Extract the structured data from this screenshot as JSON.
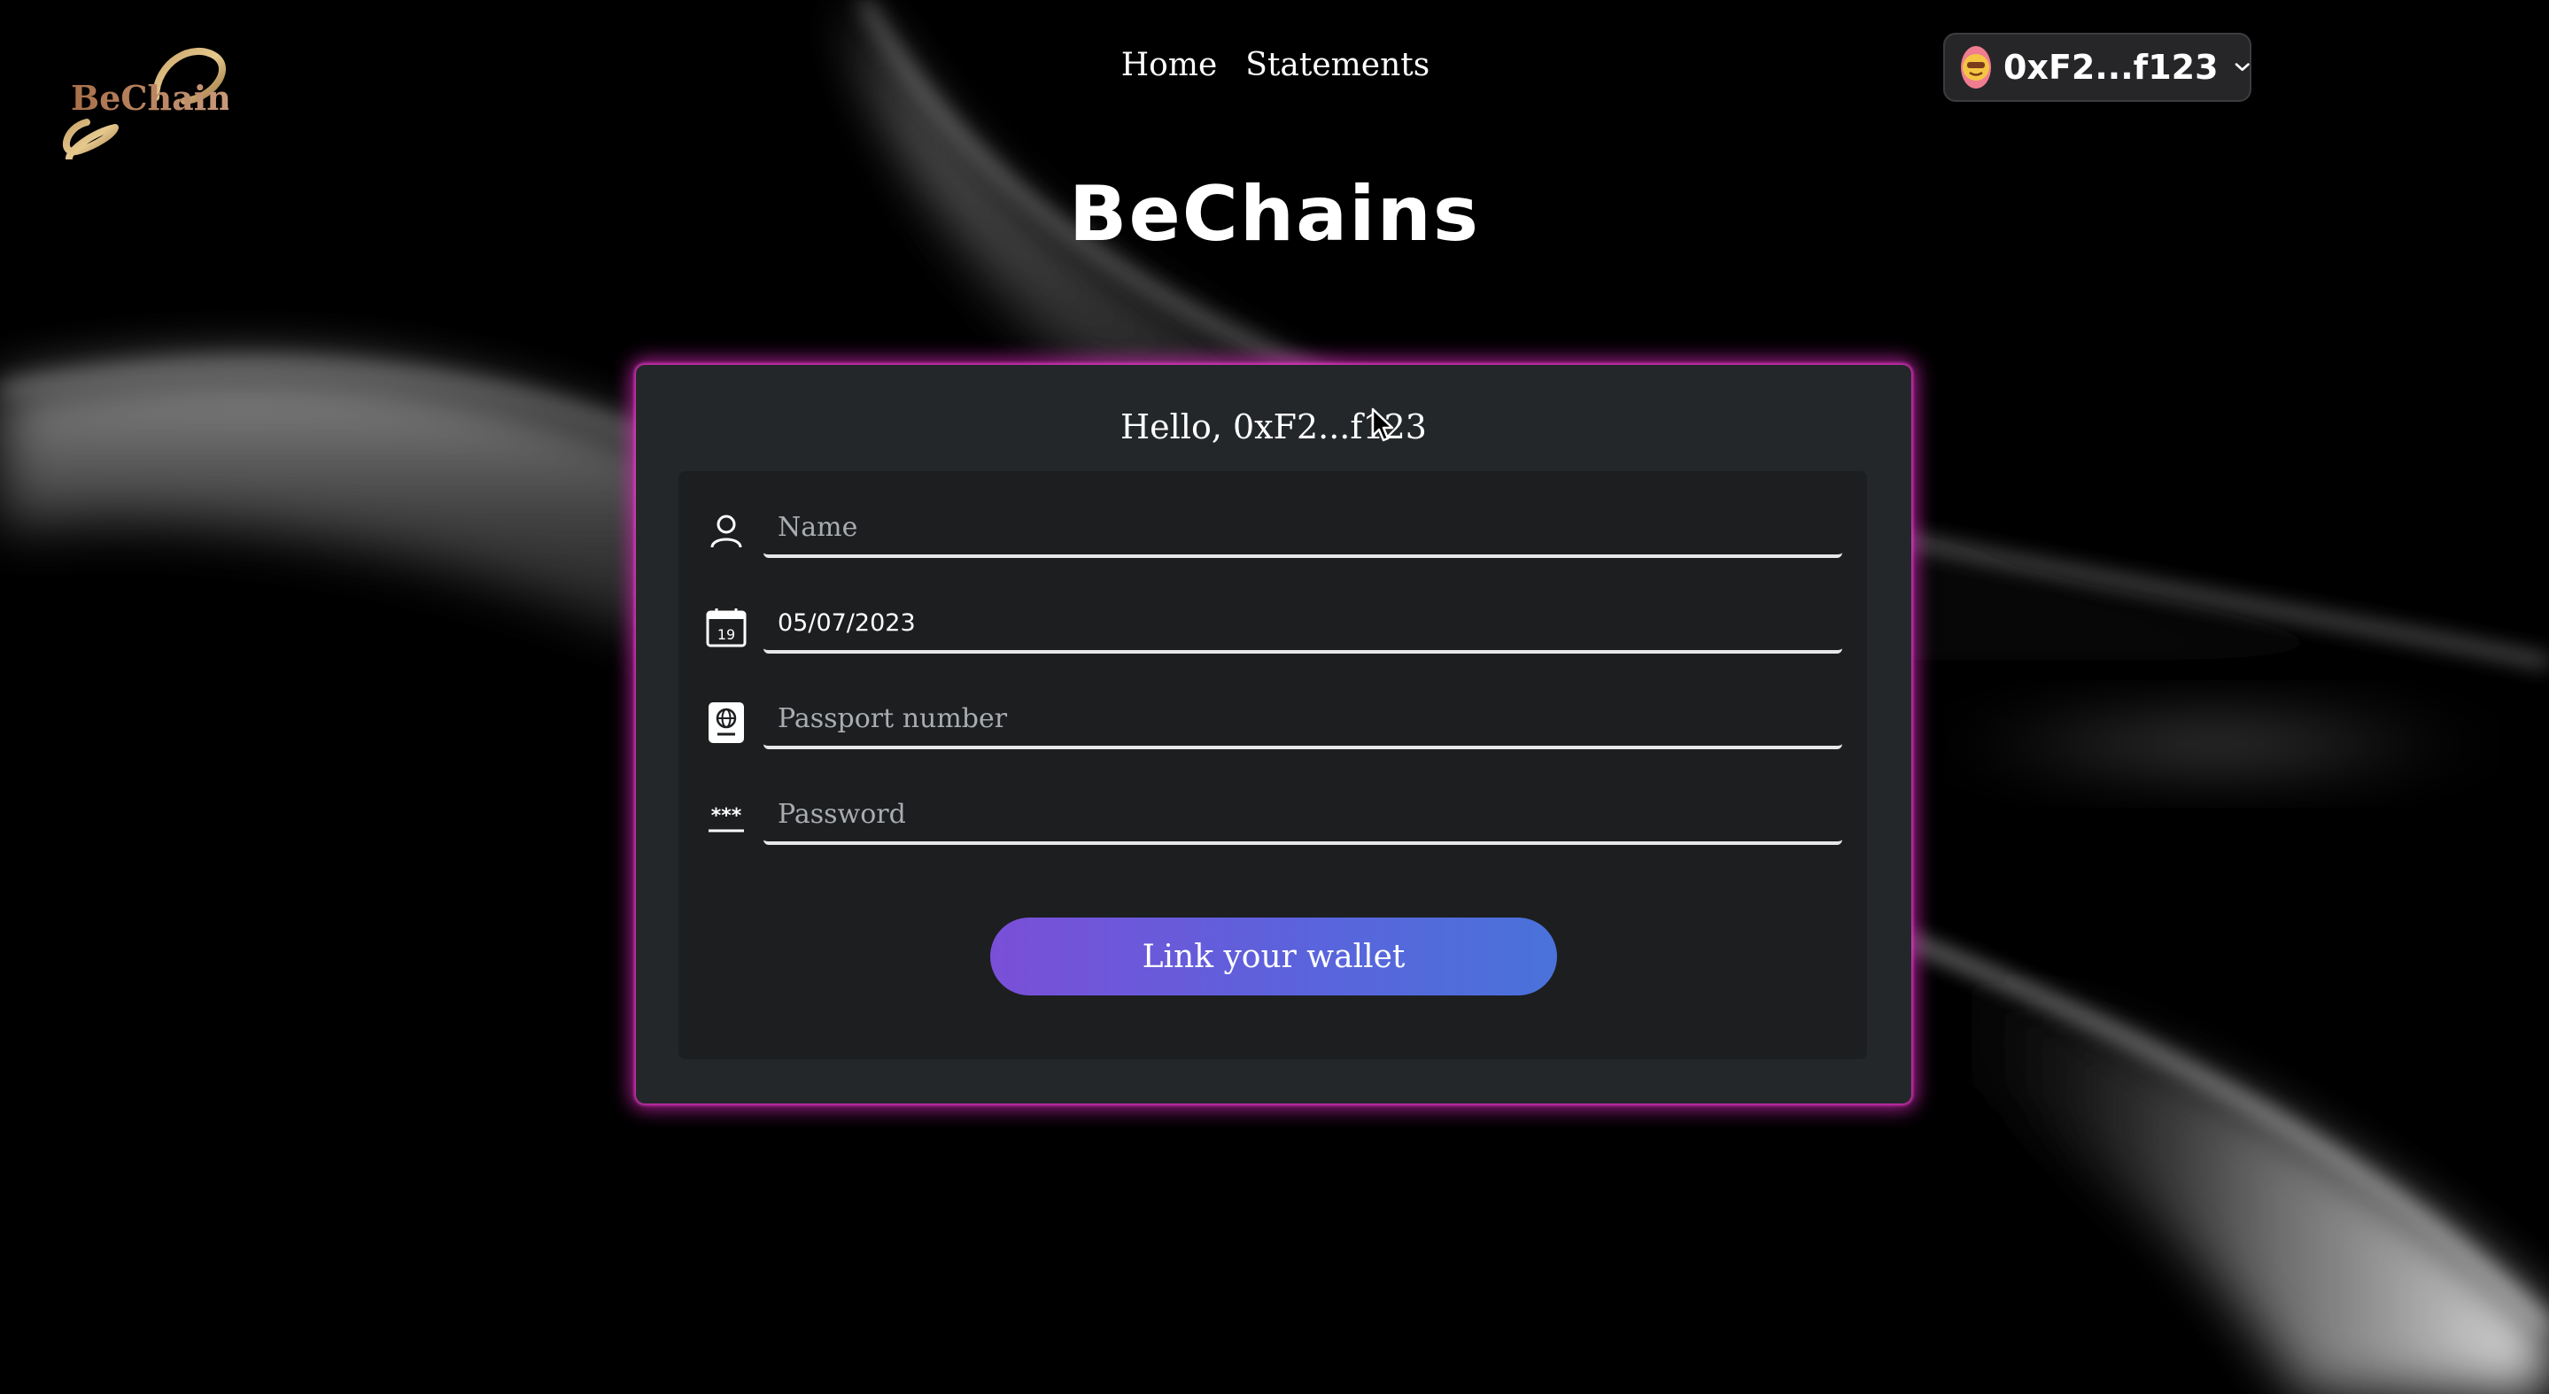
{
  "logo": {
    "text": "BeChain"
  },
  "nav": {
    "items": [
      {
        "label": "Home"
      },
      {
        "label": "Statements"
      }
    ]
  },
  "wallet": {
    "address": "0xF2...f123",
    "avatar_icon": "face-emoji-icon",
    "avatar_color": "#f07c90"
  },
  "site_title": "BeChains",
  "card": {
    "greeting": "Hello, 0xF2...f123",
    "fields": {
      "name": {
        "placeholder": "Name",
        "value": "",
        "icon": "user-icon"
      },
      "date": {
        "placeholder": "",
        "value": "05/07/2023",
        "icon": "calendar-icon",
        "icon_text": "19"
      },
      "passport": {
        "placeholder": "Passport number",
        "value": "",
        "icon": "passport-icon"
      },
      "password": {
        "placeholder": "Password",
        "value": "",
        "icon": "password-icon",
        "icon_text": "***"
      }
    },
    "submit_label": "Link your wallet"
  },
  "colors": {
    "background": "#000000",
    "card": "#24272a",
    "card_glow": "#da28be",
    "button_start": "#7a4fd8",
    "button_end": "#4a72da"
  }
}
